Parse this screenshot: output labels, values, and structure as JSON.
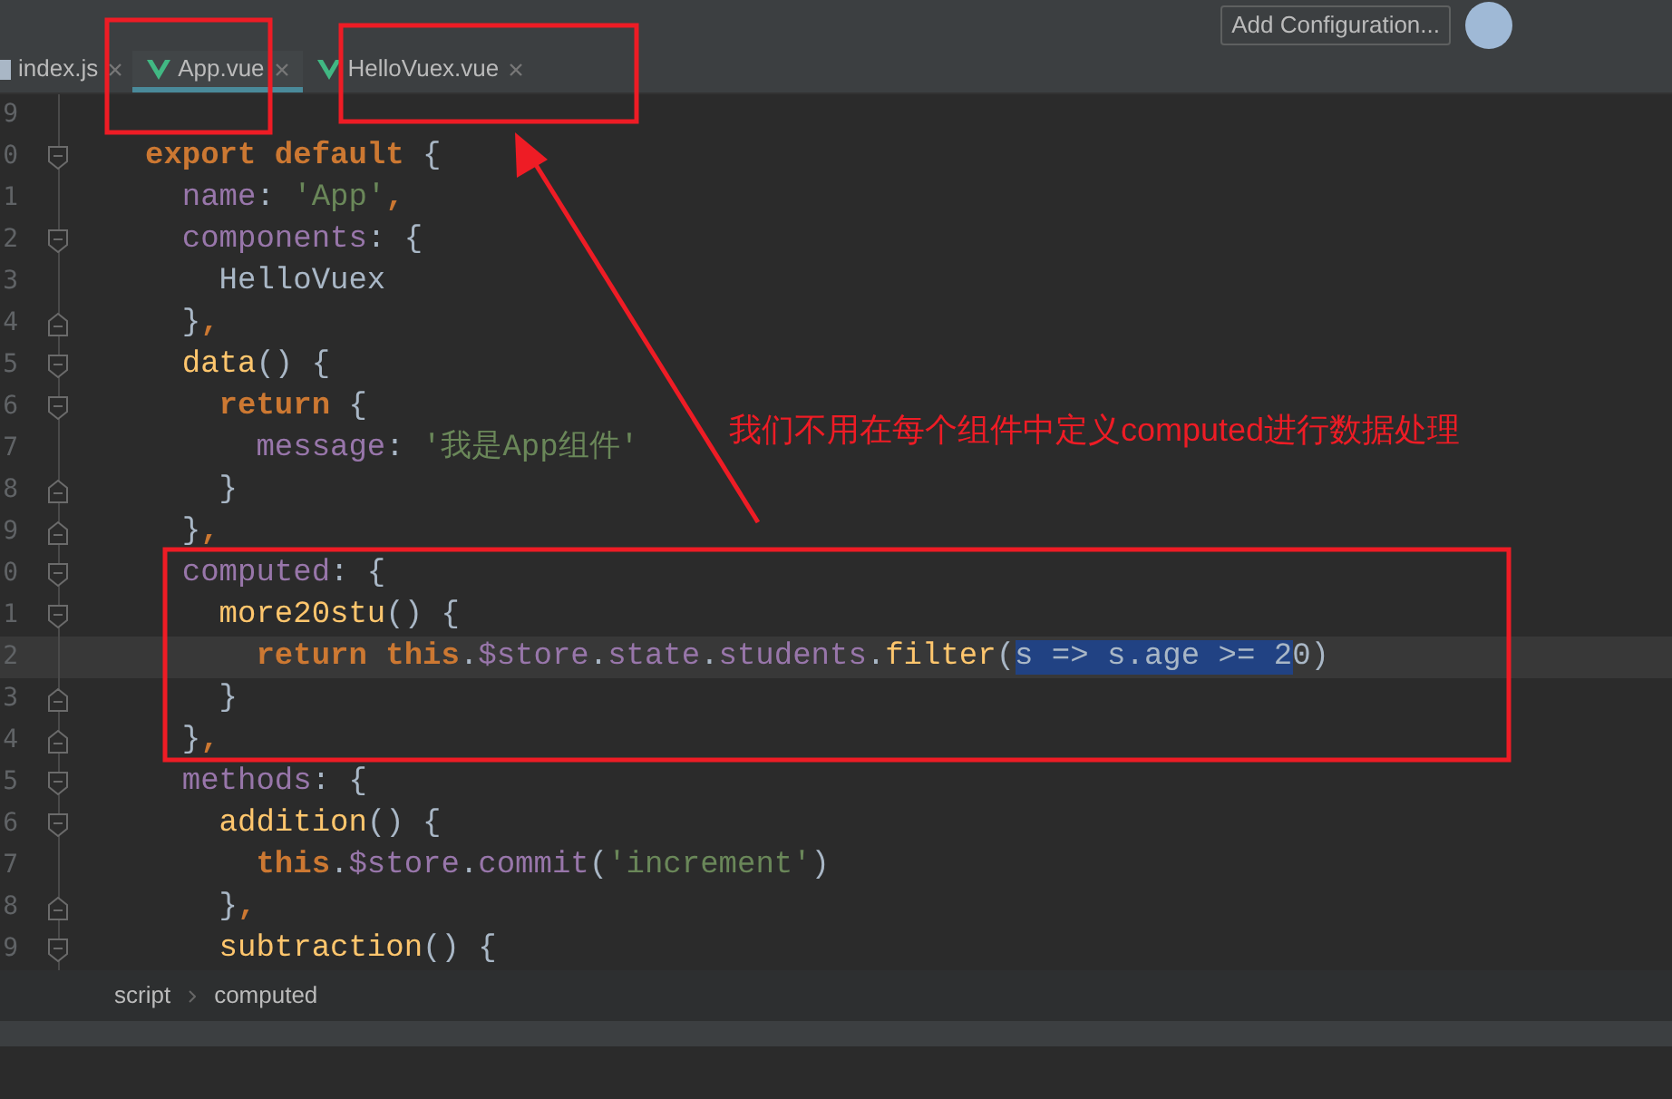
{
  "toolbar": {
    "run_config": "Add Configuration..."
  },
  "tabs": [
    {
      "label": "index.js",
      "kind": "js",
      "selected": false
    },
    {
      "label": "App.vue",
      "kind": "vue",
      "selected": true
    },
    {
      "label": "HelloVuex.vue",
      "kind": "vue",
      "selected": false
    }
  ],
  "editor": {
    "lines": [
      {
        "number": "9",
        "current": false,
        "kind": "plain"
      },
      {
        "number": "0",
        "current": false,
        "kind": "fold-start",
        "tokens": [
          {
            "kind": "keyword",
            "text": "export default"
          },
          {
            "kind": "plain",
            "text": " {"
          }
        ]
      },
      {
        "number": "1",
        "current": false,
        "kind": "plain",
        "tokens": [
          {
            "kind": "prop",
            "text": "  name"
          },
          {
            "kind": "plain",
            "text": ": "
          },
          {
            "kind": "string",
            "text": "'App'"
          },
          {
            "kind": "keyword",
            "text": ","
          }
        ]
      },
      {
        "number": "2",
        "current": false,
        "kind": "fold-start",
        "tokens": [
          {
            "kind": "prop",
            "text": "  components"
          },
          {
            "kind": "plain",
            "text": ": {"
          }
        ]
      },
      {
        "number": "3",
        "current": false,
        "kind": "plain",
        "tokens": [
          {
            "kind": "plain",
            "text": "    HelloVuex"
          }
        ]
      },
      {
        "number": "4",
        "current": false,
        "kind": "fold-end",
        "tokens": [
          {
            "kind": "plain",
            "text": "  }"
          },
          {
            "kind": "keyword",
            "text": ","
          }
        ]
      },
      {
        "number": "5",
        "current": false,
        "kind": "fold-start",
        "tokens": [
          {
            "kind": "method",
            "text": "  data"
          },
          {
            "kind": "plain",
            "text": "() {"
          }
        ]
      },
      {
        "number": "6",
        "current": false,
        "kind": "fold-start",
        "tokens": [
          {
            "kind": "keyword",
            "text": "    return"
          },
          {
            "kind": "plain",
            "text": " {"
          }
        ]
      },
      {
        "number": "7",
        "current": false,
        "kind": "plain",
        "tokens": [
          {
            "kind": "prop",
            "text": "      message"
          },
          {
            "kind": "plain",
            "text": ": "
          },
          {
            "kind": "string",
            "text": "'我是App组件'"
          }
        ]
      },
      {
        "number": "8",
        "current": false,
        "kind": "fold-end",
        "tokens": [
          {
            "kind": "plain",
            "text": "    }"
          }
        ]
      },
      {
        "number": "9",
        "current": false,
        "kind": "fold-end",
        "tokens": [
          {
            "kind": "plain",
            "text": "  }"
          },
          {
            "kind": "keyword",
            "text": ","
          }
        ]
      },
      {
        "number": "0",
        "current": false,
        "kind": "fold-start",
        "tokens": [
          {
            "kind": "prop",
            "text": "  computed"
          },
          {
            "kind": "plain",
            "text": ": {"
          }
        ]
      },
      {
        "number": "1",
        "current": false,
        "kind": "fold-start",
        "tokens": [
          {
            "kind": "method",
            "text": "    more20stu"
          },
          {
            "kind": "plain",
            "text": "() {"
          }
        ]
      },
      {
        "number": "2",
        "current": true,
        "kind": "plain",
        "tokens": [
          {
            "kind": "keyword",
            "text": "      return this"
          },
          {
            "kind": "plain",
            "text": "."
          },
          {
            "kind": "prop",
            "text": "$store"
          },
          {
            "kind": "plain",
            "text": "."
          },
          {
            "kind": "prop",
            "text": "state"
          },
          {
            "kind": "plain",
            "text": "."
          },
          {
            "kind": "prop",
            "text": "students"
          },
          {
            "kind": "plain",
            "text": "."
          },
          {
            "kind": "method",
            "text": "filter"
          },
          {
            "kind": "plain",
            "text": "("
          },
          {
            "kind": "selection",
            "text": "s => s.age >= 2"
          },
          {
            "kind": "plain",
            "text": "0)"
          }
        ]
      },
      {
        "number": "3",
        "current": false,
        "kind": "fold-end",
        "tokens": [
          {
            "kind": "plain",
            "text": "    }"
          }
        ]
      },
      {
        "number": "4",
        "current": false,
        "kind": "fold-end",
        "tokens": [
          {
            "kind": "plain",
            "text": "  }"
          },
          {
            "kind": "keyword",
            "text": ","
          }
        ]
      },
      {
        "number": "5",
        "current": false,
        "kind": "fold-start",
        "tokens": [
          {
            "kind": "prop",
            "text": "  methods"
          },
          {
            "kind": "plain",
            "text": ": {"
          }
        ]
      },
      {
        "number": "6",
        "current": false,
        "kind": "fold-start",
        "tokens": [
          {
            "kind": "method",
            "text": "    addition"
          },
          {
            "kind": "plain",
            "text": "() {"
          }
        ]
      },
      {
        "number": "7",
        "current": false,
        "kind": "plain",
        "tokens": [
          {
            "kind": "keyword",
            "text": "      this"
          },
          {
            "kind": "plain",
            "text": "."
          },
          {
            "kind": "prop",
            "text": "$store"
          },
          {
            "kind": "plain",
            "text": "."
          },
          {
            "kind": "prop",
            "text": "commit"
          },
          {
            "kind": "plain",
            "text": "("
          },
          {
            "kind": "string",
            "text": "'increment'"
          },
          {
            "kind": "plain",
            "text": ")"
          }
        ]
      },
      {
        "number": "8",
        "current": false,
        "kind": "fold-end",
        "tokens": [
          {
            "kind": "plain",
            "text": "    }"
          },
          {
            "kind": "keyword",
            "text": ","
          }
        ]
      },
      {
        "number": "9",
        "current": false,
        "kind": "fold-start",
        "tokens": [
          {
            "kind": "method",
            "text": "    subtraction"
          },
          {
            "kind": "plain",
            "text": "() {"
          }
        ]
      }
    ]
  },
  "breadcrumb": [
    "script",
    "computed"
  ],
  "annotation": {
    "text": "我们不用在每个组件中定义computed进行数据处理"
  }
}
